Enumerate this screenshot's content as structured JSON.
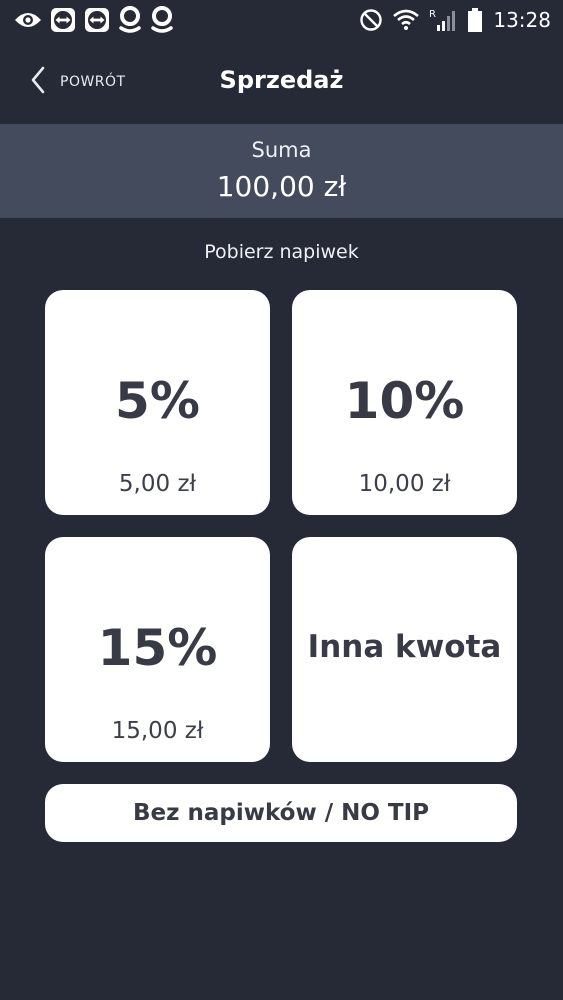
{
  "status_bar": {
    "time": "13:28",
    "left_icons": [
      "eye-icon",
      "teamviewer-icon",
      "teamviewer-icon",
      "location-pin-icon",
      "location-pin-icon"
    ],
    "right_icons": [
      "do-not-disturb-icon",
      "wifi-icon",
      "cellular-signal-icon",
      "battery-icon"
    ],
    "roaming_indicator": "R"
  },
  "nav": {
    "back_label": "POWRÓT",
    "title": "Sprzedaż"
  },
  "sum": {
    "label": "Suma",
    "value": "100,00 zł"
  },
  "tip": {
    "prompt": "Pobierz napiwek",
    "options": [
      {
        "percent": "5%",
        "amount": "5,00 zł"
      },
      {
        "percent": "10%",
        "amount": "10,00 zł"
      },
      {
        "percent": "15%",
        "amount": "15,00 zł"
      }
    ],
    "other_label": "Inna kwota",
    "no_tip_label": "Bez napiwków / NO TIP"
  },
  "colors": {
    "background": "#262a36",
    "sum_panel": "#434b5c",
    "card": "#ffffff",
    "card_text": "#383b46"
  }
}
